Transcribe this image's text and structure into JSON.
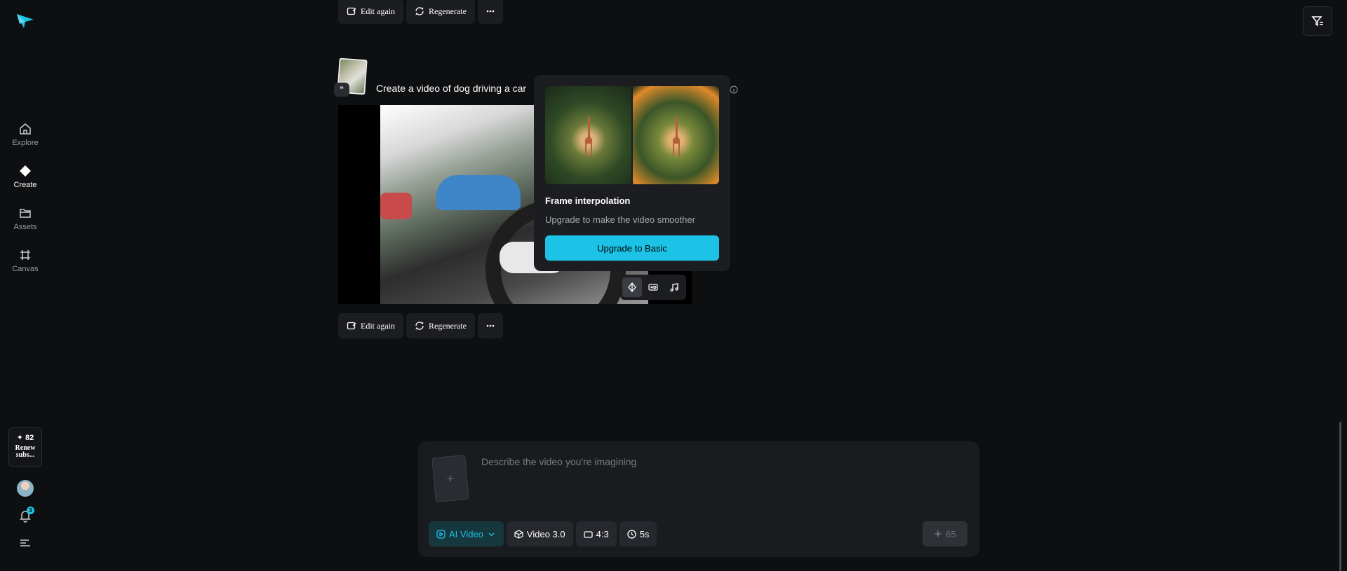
{
  "sidebar": {
    "items": [
      {
        "label": "Explore",
        "icon": "home-icon"
      },
      {
        "label": "Create",
        "icon": "diamond-icon"
      },
      {
        "label": "Assets",
        "icon": "folder-icon"
      },
      {
        "label": "Canvas",
        "icon": "canvas-icon"
      }
    ],
    "credits": "82",
    "renew": "Renew subs...",
    "notification_count": "3"
  },
  "actions": {
    "edit_again": "Edit again",
    "regenerate": "Regenerate"
  },
  "generation": {
    "prompt": "Create a video of dog driving a car",
    "info_label": "nfo"
  },
  "popover": {
    "title": "Frame interpolation",
    "subtitle": "Upgrade to make the video smoother",
    "button": "Upgrade to Basic"
  },
  "composer": {
    "placeholder": "Describe the video you're imagining",
    "mode": "AI Video",
    "model": "Video 3.0",
    "ratio": "4:3",
    "duration": "5s",
    "cost": "65"
  },
  "colors": {
    "accent": "#1cc3e6",
    "background": "#0e0f11"
  }
}
